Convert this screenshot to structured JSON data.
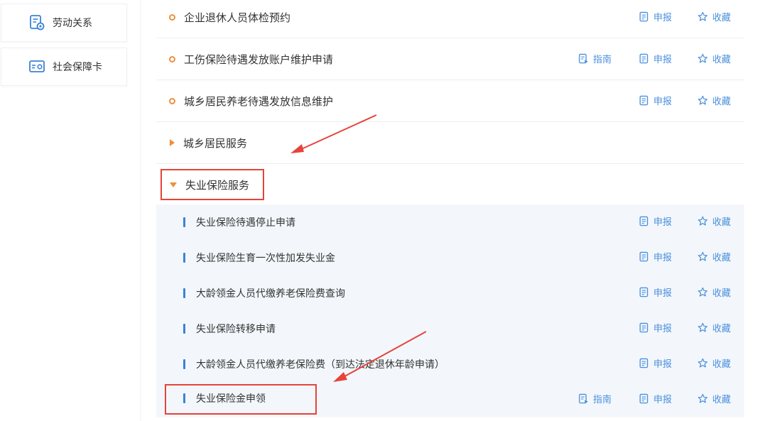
{
  "sidebar": {
    "items": [
      {
        "label": "劳动关系",
        "icon": "labor-document-icon"
      },
      {
        "label": "社会保障卡",
        "icon": "social-security-card-icon"
      }
    ]
  },
  "actions": {
    "guide": "指南",
    "apply": "申报",
    "favorite": "收藏"
  },
  "main": {
    "rows": [
      {
        "title": "企业退休人员体检预约",
        "has_guide": false
      },
      {
        "title": "工伤保险待遇发放账户维护申请",
        "has_guide": true
      },
      {
        "title": "城乡居民养老待遇发放信息维护",
        "has_guide": false
      }
    ],
    "groups": [
      {
        "title": "城乡居民服务",
        "expanded": false
      },
      {
        "title": "失业保险服务",
        "expanded": true
      }
    ],
    "subitems": [
      {
        "title": "失业保险待遇停止申请",
        "has_guide": false
      },
      {
        "title": "失业保险生育一次性加发失业金",
        "has_guide": false
      },
      {
        "title": "大龄领金人员代缴养老保险费查询",
        "has_guide": false
      },
      {
        "title": "失业保险转移申请",
        "has_guide": false
      },
      {
        "title": "大龄领金人员代缴养老保险费（到达法定退休年龄申请）",
        "has_guide": false
      },
      {
        "title": "失业保险金申领",
        "has_guide": true
      }
    ]
  },
  "colors": {
    "accent_orange": "#ef8e3c",
    "link_blue": "#4a8fdd",
    "annotation_red": "#e6433a",
    "subpanel_bg": "#f3f7fb"
  }
}
